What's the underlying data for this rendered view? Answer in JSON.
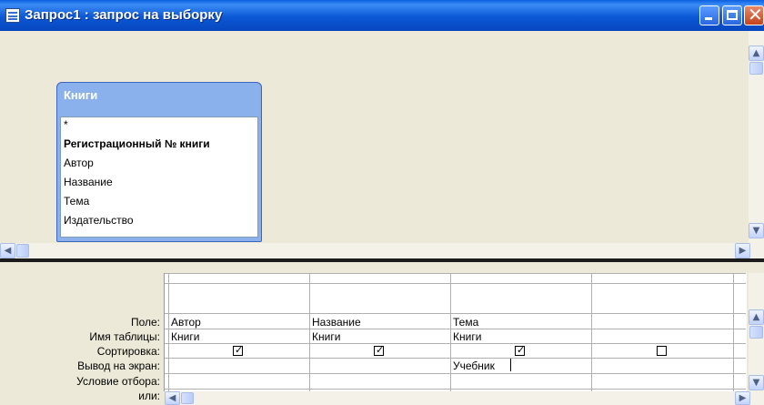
{
  "window": {
    "title": "Запрос1 : запрос на выборку"
  },
  "table": {
    "name": "Книги",
    "fields": [
      "*",
      "Регистрационный № книги",
      "Автор",
      "Название",
      "Тема",
      "Издательство"
    ],
    "key_field": "Регистрационный № книги"
  },
  "grid": {
    "row_labels": {
      "field": "Поле:",
      "table": "Имя таблицы:",
      "sort": "Сортировка:",
      "show": "Вывод на экран:",
      "criteria": "Условие отбора:",
      "or": "или:"
    },
    "columns": [
      {
        "field": "Автор",
        "table": "Книги",
        "sort": "",
        "show": true,
        "criteria": "",
        "or": ""
      },
      {
        "field": "Название",
        "table": "Книги",
        "sort": "",
        "show": true,
        "criteria": "",
        "or": ""
      },
      {
        "field": "Тема",
        "table": "Книги",
        "sort": "",
        "show": true,
        "criteria": "Учебник",
        "or": ""
      },
      {
        "field": "",
        "table": "",
        "sort": "",
        "show": false,
        "criteria": "",
        "or": ""
      }
    ]
  },
  "icons": {
    "title": "query-window-icon",
    "minimize": "minimize-icon",
    "maximize": "maximize-icon",
    "close": "close-icon"
  },
  "colors": {
    "titlebar": "#0b58d6",
    "table_header": "#8ab1ec",
    "pane_background": "#ece9d8",
    "close_button": "#c4431d"
  }
}
